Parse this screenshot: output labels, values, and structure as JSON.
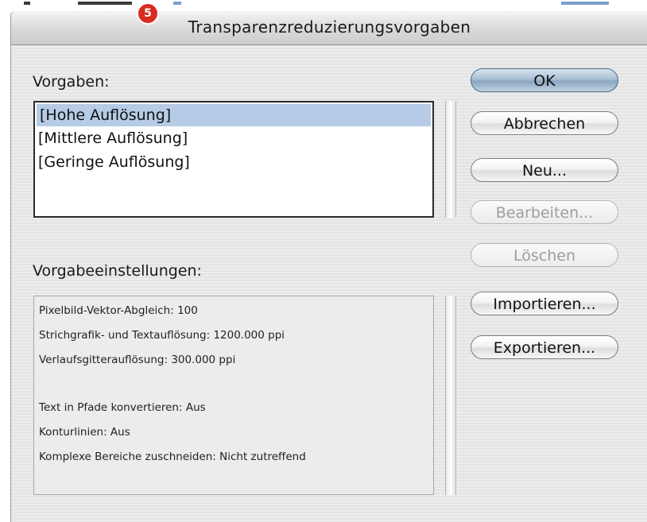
{
  "window": {
    "title": "Transparenzreduzierungsvorgaben",
    "step_badge": "5"
  },
  "presets": {
    "label": "Vorgaben:",
    "items": [
      "[Hohe Auflösung]",
      "[Mittlere Auflösung]",
      "[Geringe Auflösung]"
    ],
    "selected_index": 0
  },
  "settings": {
    "label": "Vorgabeeinstellungen:",
    "lines": [
      "Pixelbild-Vektor-Abgleich: 100",
      "Strichgrafik- und Textauflösung: 1200.000 ppi",
      "Verlaufsgitterauflösung: 300.000 ppi",
      "Text in Pfade konvertieren: Aus",
      "Konturlinien: Aus",
      "Komplexe Bereiche zuschneiden: Nicht zutreffend"
    ]
  },
  "buttons": {
    "ok": "OK",
    "cancel": "Abbrechen",
    "new": "Neu...",
    "edit": "Bearbeiten...",
    "delete": "Löschen",
    "import": "Importieren...",
    "export": "Exportieren..."
  },
  "colors": {
    "selection": "#b5cbe6",
    "default_button": "#a9bfd4",
    "badge": "#d92b1f",
    "disabled_text": "#9d9d9d"
  }
}
